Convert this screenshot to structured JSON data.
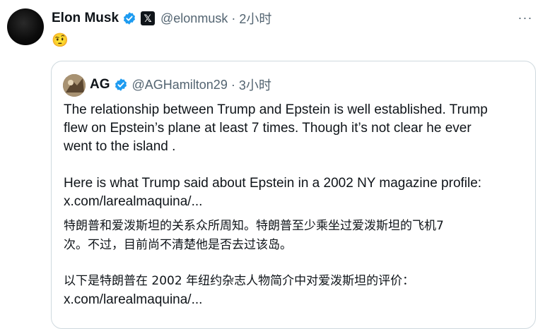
{
  "tweet": {
    "author": {
      "name": "Elon Musk",
      "handle": "@elonmusk",
      "time": "2小时",
      "verified_color": "#1d9bf0",
      "affiliation_glyph": "𝕏"
    },
    "dot": "·",
    "more_glyph": "···",
    "text": "🤨",
    "quote": {
      "author": {
        "name": "AG",
        "handle": "@AGHamilton29",
        "time": "3小时"
      },
      "lines": [
        "The relationship between Trump and Epstein is well established. Trump",
        "flew on Epstein’s plane at least 7 times. Though it’s not clear he ever",
        "went to the island .",
        "Here is what Trump said about Epstein in a 2002 NY magazine profile:",
        "x.com/larealmaquina/...",
        "特朗普和爱泼斯坦的关系众所周知。特朗普至少乘坐过爱泼斯坦的飞机7",
        "次。不过，目前尚不清楚他是否去过该岛。",
        "以下是特朗普在 2002 年纽约杂志人物简介中对爱泼斯坦的评价：",
        "x.com/larealmaquina/..."
      ]
    }
  }
}
